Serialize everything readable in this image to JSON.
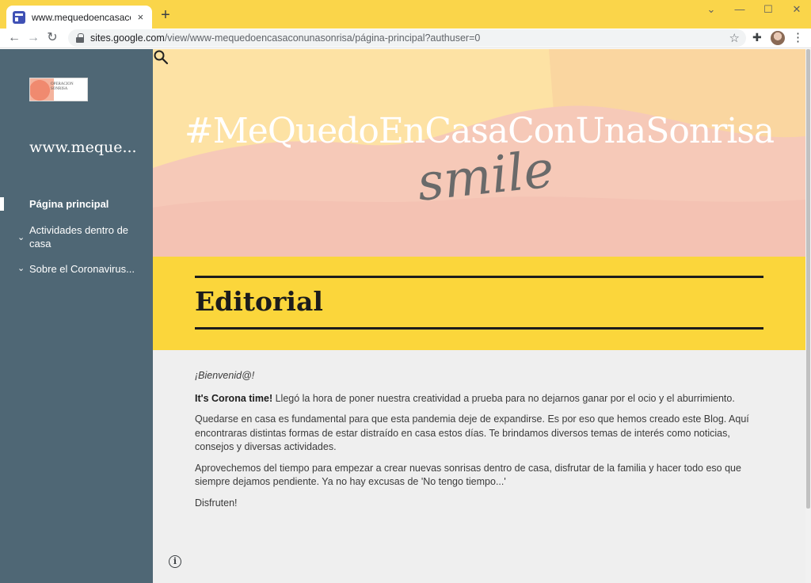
{
  "browser": {
    "tab_title": "www.mequedoencasaconunasonrisa",
    "tab_close": "×",
    "new_tab": "+",
    "url_host": "sites.google.com",
    "url_path": "/view/www-mequedoencasaconunasonrisa/página-principal?authuser=0",
    "window_controls": {
      "minimize": "—",
      "maximize": "☐",
      "close": "✕",
      "dropdown": "⌄"
    }
  },
  "sidebar": {
    "logo_text": "OPERACION SONRISA",
    "site_title": "www.meque...",
    "items": [
      {
        "label": "Página principal",
        "active": true
      },
      {
        "label": "Actividades dentro de casa",
        "expandable": true
      },
      {
        "label": "Sobre el Coronavirus...",
        "expandable": true
      }
    ]
  },
  "hero": {
    "title": "#MeQuedoEnCasaConUnaSonrisa",
    "script": "smile"
  },
  "section": {
    "heading": "Editorial"
  },
  "article": {
    "welcome": "¡Bienvenid@!",
    "p1_bold": "It's Corona time!",
    "p1_rest": " Llegó la hora de poner nuestra creatividad a prueba para no dejarnos ganar por el ocio y el aburrimiento.",
    "p2": "Quedarse en casa es fundamental para que esta pandemia deje de expandirse. Es por eso que hemos creado este Blog. Aquí encontraras distintas formas de estar distraído en casa estos días. Te brindamos diversos temas de interés como noticias, consejos y diversas actividades.",
    "p3": " Aprovechemos del tiempo para empezar a crear nuevas sonrisas dentro de casa, disfrutar de la familia y hacer todo eso que siempre dejamos pendiente. Ya no hay excusas de 'No tengo tiempo...'",
    "p4": "Disfruten!"
  },
  "colors": {
    "chrome_yellow": "#fad54a",
    "sidebar": "#4f6775",
    "band_yellow": "#fbd63b",
    "hero_peach": "#f6c9b8",
    "hero_cream": "#fde2a4"
  },
  "icons": [
    "page-favicon-icon",
    "back-arrow-icon",
    "forward-arrow-icon",
    "reload-icon",
    "lock-icon",
    "star-icon",
    "extensions-icon",
    "menu-icon",
    "search-icon",
    "chevron-down-icon",
    "info-icon"
  ]
}
